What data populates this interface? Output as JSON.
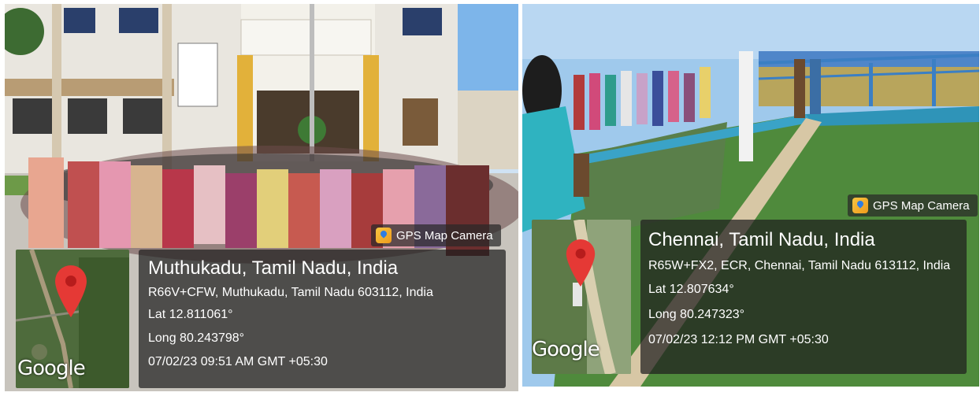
{
  "photos": [
    {
      "gps_badge": "GPS Map Camera",
      "location_title": "Muthukadu, Tamil Nadu, India",
      "address": "R66V+CFW, Muthukadu, Tamil Nadu 603112, India",
      "latitude": "Lat 12.811061°",
      "longitude": "Long 80.243798°",
      "datetime": "07/02/23 09:51 AM GMT +05:30",
      "map_brand": "Google",
      "pin_icon": "map-pin-icon"
    },
    {
      "gps_badge": "GPS Map Camera",
      "location_title": "Chennai, Tamil Nadu, India",
      "address": "R65W+FX2, ECR, Chennai, Tamil Nadu 613112, India",
      "latitude": "Lat 12.807634°",
      "longitude": "Long 80.247323°",
      "datetime": "07/02/23 12:12 PM GMT +05:30",
      "map_brand": "Google",
      "pin_icon": "map-pin-icon"
    }
  ],
  "colors": {
    "pin_red": "#e53935",
    "overlay_dark": "#1e1e1e",
    "sky": "#9fc9ec",
    "pool_water": "#4f8a3c"
  }
}
